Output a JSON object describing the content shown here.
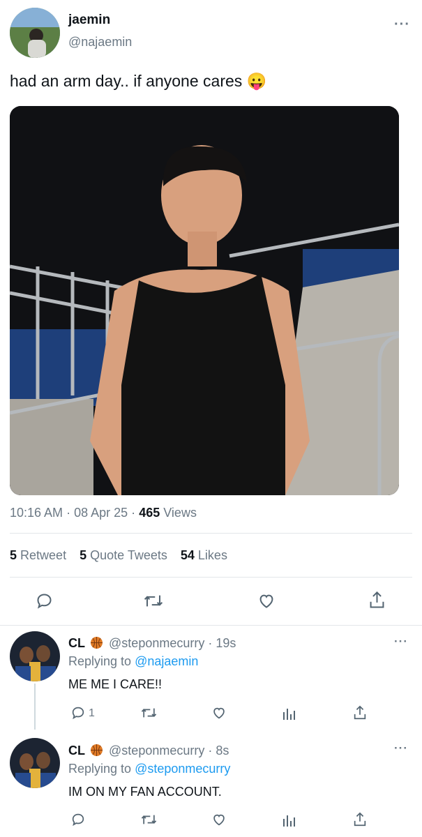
{
  "tweet": {
    "display_name": "jaemin",
    "handle": "@najaemin",
    "text": "had an arm day.. if anyone cares 😛",
    "time": "10:16 AM",
    "date": "08 Apr 25",
    "views_count": "465",
    "views_label": "Views",
    "retweets_count": "5",
    "retweets_label": "Retweet",
    "quotes_count": "5",
    "quotes_label": "Quote Tweets",
    "likes_count": "54",
    "likes_label": "Likes"
  },
  "replies": [
    {
      "display_name": "CL",
      "badge_icon": "basketball-icon",
      "handle": "@steponmecurry",
      "time": "19s",
      "replying_prefix": "Replying to",
      "replying_handle": "@najaemin",
      "text": "ME ME I CARE!!",
      "reply_count": "1"
    },
    {
      "display_name": "CL",
      "badge_icon": "basketball-icon",
      "handle": "@steponmecurry",
      "time": "8s",
      "replying_prefix": "Replying to",
      "replying_handle": "@steponmecurry",
      "text": "IM ON MY FAN ACCOUNT.",
      "reply_count": ""
    }
  ],
  "separator": "·",
  "colors": {
    "link": "#1d9bf0",
    "muted": "#6b7884",
    "text": "#0f1419"
  }
}
